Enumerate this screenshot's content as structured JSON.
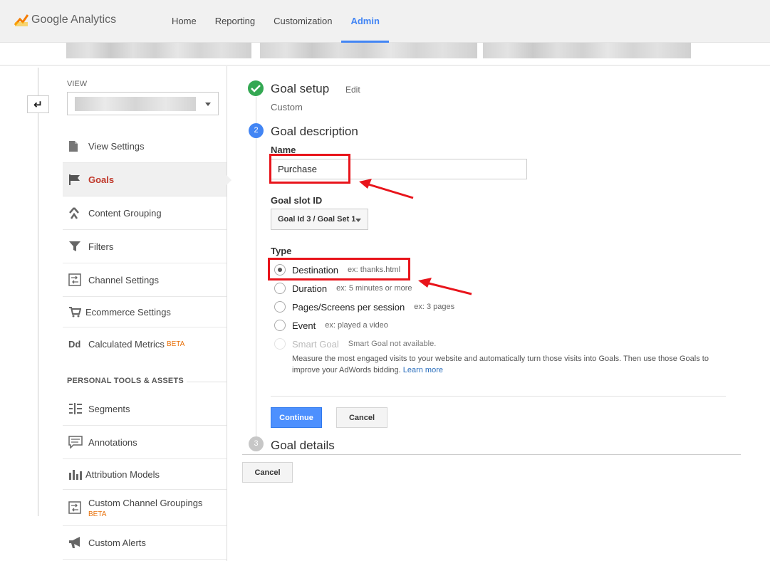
{
  "app": {
    "name": "Google Analytics"
  },
  "nav": {
    "home": "Home",
    "reporting": "Reporting",
    "customization": "Customization",
    "admin": "Admin"
  },
  "left": {
    "view_label": "VIEW",
    "menu": [
      {
        "label": "View Settings",
        "icon": "document-icon"
      },
      {
        "label": "Goals",
        "icon": "flag-icon",
        "active": true
      },
      {
        "label": "Content Grouping",
        "icon": "grouping-icon"
      },
      {
        "label": "Filters",
        "icon": "filter-icon"
      },
      {
        "label": "Channel Settings",
        "icon": "channel-icon"
      },
      {
        "label": "Ecommerce Settings",
        "icon": "cart-icon"
      },
      {
        "label": "Calculated Metrics",
        "icon": "dd-icon",
        "badge": "BETA"
      }
    ],
    "section_title": "PERSONAL TOOLS & ASSETS",
    "tools": [
      {
        "label": "Segments",
        "icon": "segments-icon"
      },
      {
        "label": "Annotations",
        "icon": "annotation-icon"
      },
      {
        "label": "Attribution Models",
        "icon": "attribution-icon"
      },
      {
        "label": "Custom Channel Groupings",
        "icon": "channel-icon",
        "badge": "BETA"
      },
      {
        "label": "Custom Alerts",
        "icon": "megaphone-icon"
      }
    ]
  },
  "steps": {
    "setup": {
      "title": "Goal setup",
      "edit": "Edit",
      "value": "Custom"
    },
    "description": {
      "number": "2",
      "title": "Goal description"
    },
    "details": {
      "number": "3",
      "title": "Goal details"
    }
  },
  "form": {
    "name_label": "Name",
    "name_value": "Purchase",
    "slot_label": "Goal slot ID",
    "slot_value": "Goal Id 3 / Goal Set 1",
    "type_label": "Type",
    "types": [
      {
        "label": "Destination",
        "hint": "ex: thanks.html",
        "selected": true
      },
      {
        "label": "Duration",
        "hint": "ex: 5 minutes or more"
      },
      {
        "label": "Pages/Screens per session",
        "hint": "ex: 3 pages"
      },
      {
        "label": "Event",
        "hint": "ex: played a video"
      },
      {
        "label": "Smart Goal",
        "hint": "Smart Goal not available.",
        "disabled": true
      }
    ],
    "smart_desc": "Measure the most engaged visits to your website and automatically turn those visits into Goals. Then use those Goals to improve your AdWords bidding.",
    "learn_more": "Learn more",
    "continue": "Continue",
    "cancel_inner": "Cancel",
    "cancel_outer": "Cancel"
  },
  "colors": {
    "accent": "#4285f4",
    "active_nav": "#c0392b",
    "beta": "#e8710a",
    "annotation": "#e8141b",
    "done": "#34a853"
  }
}
